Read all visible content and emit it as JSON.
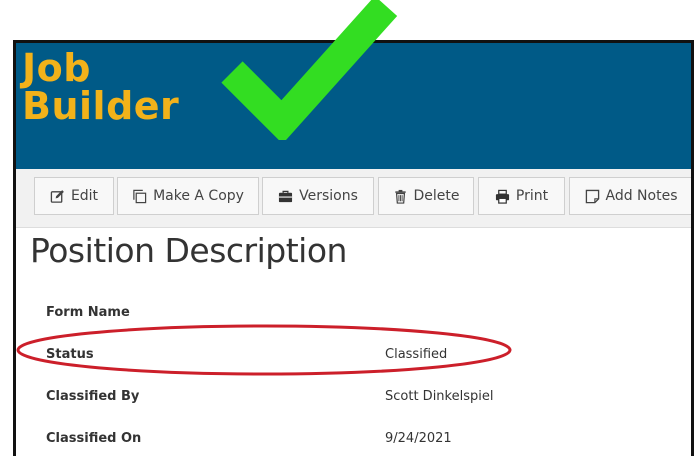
{
  "header": {
    "app_title": "Job Builder",
    "brand_color": "#005a87",
    "title_color": "#f2b21a",
    "check_color": "#33dd22"
  },
  "toolbar": {
    "buttons": [
      {
        "label": "Edit",
        "icon": "pencil-square-icon"
      },
      {
        "label": "Make A Copy",
        "icon": "copy-icon"
      },
      {
        "label": "Versions",
        "icon": "briefcase-icon"
      },
      {
        "label": "Delete",
        "icon": "trash-icon"
      },
      {
        "label": "Print",
        "icon": "printer-icon"
      },
      {
        "label": "Add Notes",
        "icon": "note-icon"
      }
    ]
  },
  "main": {
    "page_title": "Position Description",
    "fields": [
      {
        "label": "Form Name",
        "value": ""
      },
      {
        "label": "Status",
        "value": "Classified"
      },
      {
        "label": "Classified By",
        "value": "Scott Dinkelspiel"
      },
      {
        "label": "Classified On",
        "value": "9/24/2021"
      }
    ]
  },
  "annotations": {
    "highlight_color": "#cc1f2a",
    "highlighted_field": "Status"
  }
}
